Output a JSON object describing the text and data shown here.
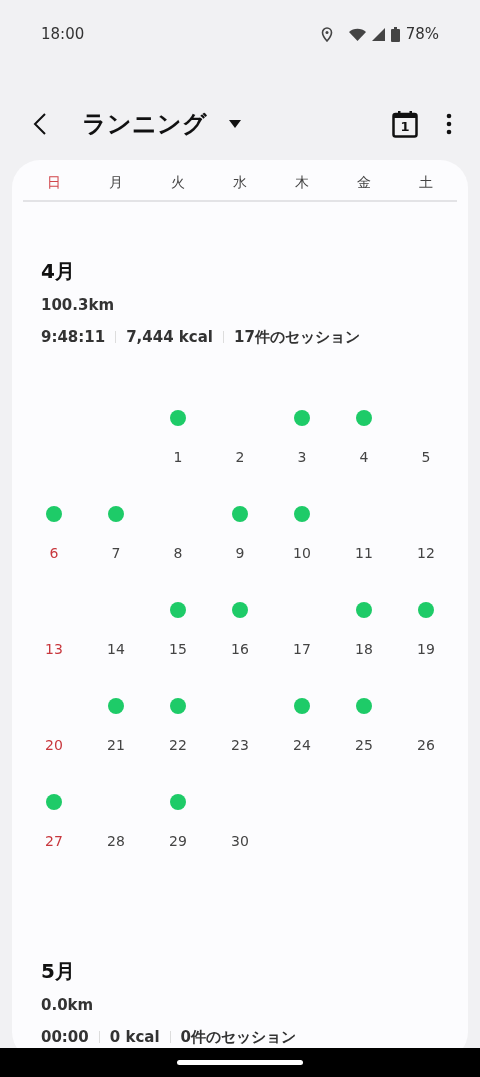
{
  "status_bar": {
    "time": "18:00",
    "battery": "78%"
  },
  "header": {
    "title": "ランニング",
    "calendar_icon_day": "1"
  },
  "weekdays": [
    "日",
    "月",
    "火",
    "水",
    "木",
    "金",
    "土"
  ],
  "months": [
    {
      "title": "4月",
      "distance": "100.3km",
      "stats": [
        "9:48:11",
        "7,444 kcal",
        "17件のセッション"
      ],
      "weeks": [
        [
          {
            "kind": "blank"
          },
          {
            "kind": "blank"
          },
          {
            "kind": "day",
            "day": "1",
            "session": true
          },
          {
            "kind": "day",
            "day": "2",
            "session": false
          },
          {
            "kind": "day",
            "day": "3",
            "session": true
          },
          {
            "kind": "day",
            "day": "4",
            "session": true
          },
          {
            "kind": "day",
            "day": "5",
            "session": false
          }
        ],
        [
          {
            "kind": "day",
            "day": "6",
            "session": true
          },
          {
            "kind": "day",
            "day": "7",
            "session": true
          },
          {
            "kind": "day",
            "day": "8",
            "session": false
          },
          {
            "kind": "day",
            "day": "9",
            "session": true
          },
          {
            "kind": "day",
            "day": "10",
            "session": true
          },
          {
            "kind": "day",
            "day": "11",
            "session": false
          },
          {
            "kind": "day",
            "day": "12",
            "session": false
          }
        ],
        [
          {
            "kind": "day",
            "day": "13",
            "session": false
          },
          {
            "kind": "day",
            "day": "14",
            "session": false
          },
          {
            "kind": "day",
            "day": "15",
            "session": true
          },
          {
            "kind": "day",
            "day": "16",
            "session": true
          },
          {
            "kind": "day",
            "day": "17",
            "session": false
          },
          {
            "kind": "day",
            "day": "18",
            "session": true
          },
          {
            "kind": "day",
            "day": "19",
            "session": true
          }
        ],
        [
          {
            "kind": "day",
            "day": "20",
            "session": false
          },
          {
            "kind": "day",
            "day": "21",
            "session": true
          },
          {
            "kind": "day",
            "day": "22",
            "session": true
          },
          {
            "kind": "day",
            "day": "23",
            "session": false
          },
          {
            "kind": "day",
            "day": "24",
            "session": true
          },
          {
            "kind": "day",
            "day": "25",
            "session": true
          },
          {
            "kind": "day",
            "day": "26",
            "session": false
          }
        ],
        [
          {
            "kind": "day",
            "day": "27",
            "session": true
          },
          {
            "kind": "day",
            "day": "28",
            "session": false
          },
          {
            "kind": "day",
            "day": "29",
            "session": true
          },
          {
            "kind": "day",
            "day": "30",
            "session": false
          }
        ]
      ]
    },
    {
      "title": "5月",
      "distance": "0.0km",
      "stats": [
        "00:00",
        "0 kcal",
        "0件のセッション"
      ]
    }
  ]
}
